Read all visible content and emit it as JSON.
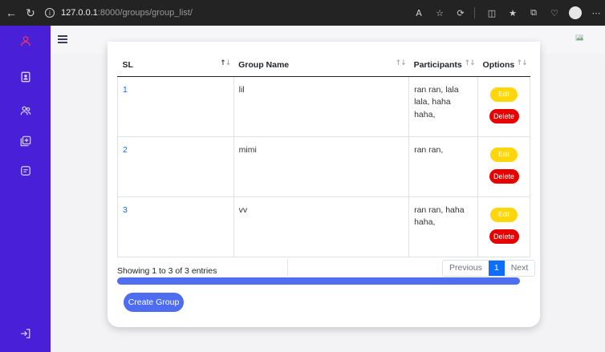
{
  "browser": {
    "url_host": "127.0.0.1",
    "url_path": ":8000/groups/group_list/"
  },
  "table": {
    "columns": [
      "SL",
      "Group Name",
      "Participants",
      "Options"
    ],
    "rows": [
      {
        "sl": "1",
        "group_name": "lil",
        "participants": "ran ran, lala lala, haha haha,"
      },
      {
        "sl": "2",
        "group_name": "mimi",
        "participants": "ran ran,"
      },
      {
        "sl": "3",
        "group_name": "vv",
        "participants": "ran ran, haha haha,"
      }
    ],
    "edit_label": "Edit",
    "delete_label": "Delete"
  },
  "footer": {
    "info": "Showing 1 to 3 of 3 entries",
    "pagination": {
      "previous": "Previous",
      "current": "1",
      "next": "Next"
    }
  },
  "actions": {
    "create_group": "Create Group"
  },
  "colors": {
    "sidebar": "#4a1fd8",
    "edit": "#ffd60a",
    "delete": "#e60000",
    "primary": "#4d6cf0"
  }
}
